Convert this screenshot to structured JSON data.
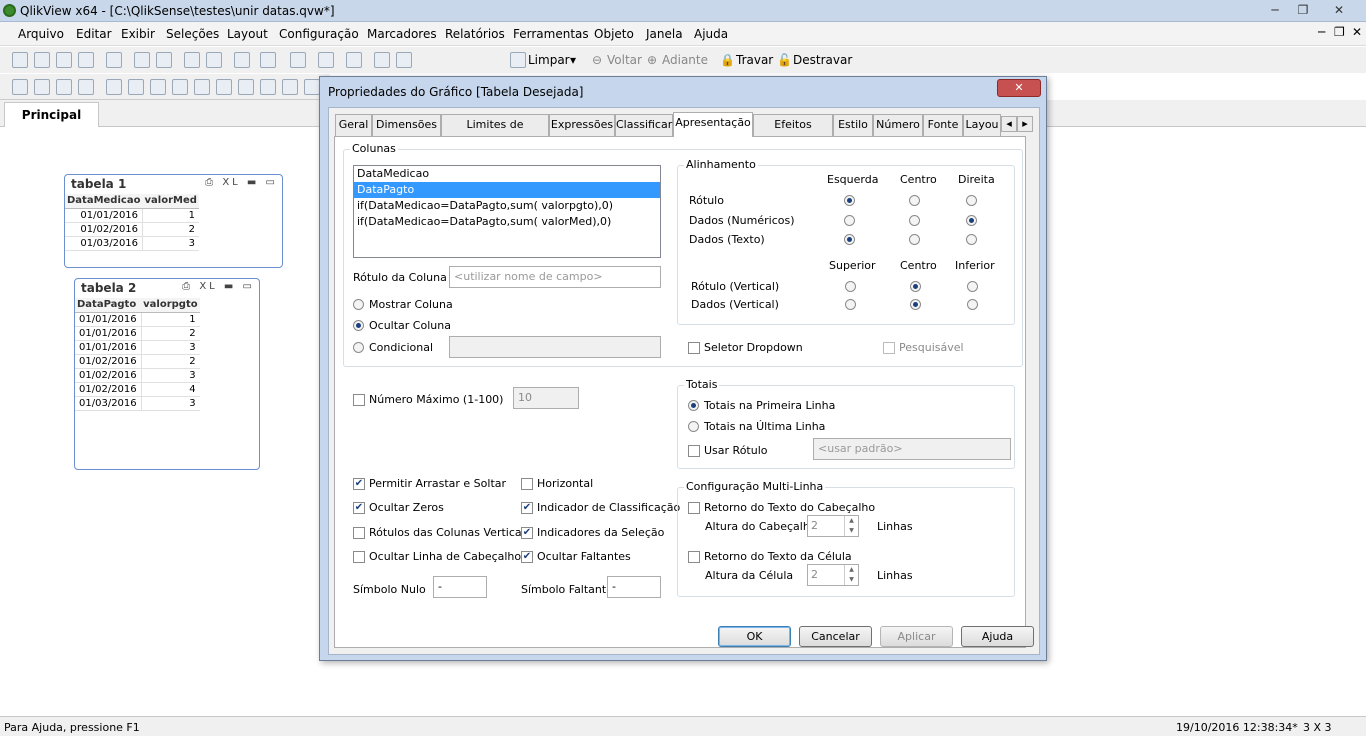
{
  "window": {
    "title": "QlikView x64 - [C:\\QlikSense\\testes\\unir datas.qvw*]",
    "min": "─",
    "max": "❐",
    "close": "✕"
  },
  "menu": [
    "Arquivo",
    "Editar",
    "Exibir",
    "Seleções",
    "Layout",
    "Configuração",
    "Marcadores",
    "Relatórios",
    "Ferramentas",
    "Objeto",
    "Janela",
    "Ajuda"
  ],
  "toolbar": {
    "limpar": "Limpar",
    "voltar": "Voltar",
    "adiante": "Adiante",
    "travar": "Travar",
    "destravar": "Destravar"
  },
  "sheet_tab": "Principal",
  "tabela1": {
    "title": "tabela 1",
    "buttons": "⎙ XL ▬ ▭",
    "headers": [
      "DataMedicao",
      "valorMed"
    ],
    "rows": [
      [
        "01/01/2016",
        "1"
      ],
      [
        "01/02/2016",
        "2"
      ],
      [
        "01/03/2016",
        "3"
      ]
    ]
  },
  "tabela2": {
    "title": "tabela 2",
    "buttons": "⎙ XL ▬ ▭",
    "headers": [
      "DataPagto",
      "valorpgto"
    ],
    "rows": [
      [
        "01/01/2016",
        "1"
      ],
      [
        "01/01/2016",
        "2"
      ],
      [
        "01/01/2016",
        "3"
      ],
      [
        "01/02/2016",
        "2"
      ],
      [
        "01/02/2016",
        "3"
      ],
      [
        "01/02/2016",
        "4"
      ],
      [
        "01/03/2016",
        "3"
      ]
    ]
  },
  "dialog": {
    "title": "Propriedades do Gráfico [Tabela Desejada]",
    "tabs": [
      "Geral",
      "Dimensões",
      "Limites de Dimensão",
      "Expressões",
      "Classificar",
      "Apresentação",
      "Efeitos Visuais",
      "Estilo",
      "Número",
      "Fonte",
      "Layou"
    ],
    "active_tab": "Apresentação",
    "colunas": {
      "legend": "Colunas",
      "items": [
        "DataMedicao",
        "DataPagto",
        "if(DataMedicao=DataPagto,sum( valorpgto),0)",
        "if(DataMedicao=DataPagto,sum( valorMed),0)"
      ],
      "selected": "DataPagto"
    },
    "rotulo_coluna": {
      "label": "Rótulo da Coluna",
      "placeholder": "<utilizar nome de campo>"
    },
    "visibility": {
      "mostrar": "Mostrar Coluna",
      "ocultar": "Ocultar Coluna",
      "condicional": "Condicional",
      "selected": "Ocultar Coluna"
    },
    "alinhamento": {
      "legend": "Alinhamento",
      "cols1": [
        "Esquerda",
        "Centro",
        "Direita"
      ],
      "rows1": [
        {
          "label": "Rótulo",
          "selected": 0
        },
        {
          "label": "Dados (Numéricos)",
          "selected": 2
        },
        {
          "label": "Dados (Texto)",
          "selected": 0
        }
      ],
      "cols2": [
        "Superior",
        "Centro",
        "Inferior"
      ],
      "rows2": [
        {
          "label": "Rótulo (Vertical)",
          "selected": 1
        },
        {
          "label": "Dados (Vertical)",
          "selected": 1
        }
      ]
    },
    "seletor_dropdown": "Seletor Dropdown",
    "pesquisavel": "Pesquisável",
    "numero_maximo": {
      "label": "Número Máximo (1-100)",
      "value": "10"
    },
    "totais": {
      "legend": "Totais",
      "primeira": "Totais na Primeira Linha",
      "ultima": "Totais na Última Linha",
      "usar_rotulo": "Usar Rótulo",
      "placeholder": "<usar padrão>",
      "selected": "Totais na Primeira Linha"
    },
    "checks": {
      "permitir_arrastar": {
        "label": "Permitir Arrastar e Soltar",
        "checked": true
      },
      "horizontal": {
        "label": "Horizontal",
        "checked": false
      },
      "ocultar_zeros": {
        "label": "Ocultar Zeros",
        "checked": true
      },
      "indicador_classificacao": {
        "label": "Indicador de Classificação",
        "checked": true
      },
      "rotulos_verticais": {
        "label": "Rótulos das Colunas Verticais",
        "checked": false
      },
      "indicadores_selecao": {
        "label": "Indicadores da Seleção",
        "checked": true
      },
      "ocultar_cabecalho": {
        "label": "Ocultar Linha de Cabeçalho",
        "checked": false
      },
      "ocultar_faltantes": {
        "label": "Ocultar Faltantes",
        "checked": true
      }
    },
    "simbolo_nulo": {
      "label": "Símbolo Nulo",
      "value": "-"
    },
    "simbolo_faltante": {
      "label": "Símbolo Faltante",
      "value": "-"
    },
    "multilinha": {
      "legend": "Configuração Multi-Linha",
      "retorno_cabecalho": "Retorno do Texto do Cabeçalho",
      "altura_cabecalho": "Altura do Cabeçalho",
      "retorno_celula": "Retorno do Texto da Célula",
      "altura_celula": "Altura da Célula",
      "value": "2",
      "linhas": "Linhas"
    },
    "buttons": {
      "ok": "OK",
      "cancelar": "Cancelar",
      "aplicar": "Aplicar",
      "ajuda": "Ajuda"
    }
  },
  "status": {
    "help": "Para Ajuda, pressione F1",
    "datetime": "19/10/2016 12:38:34*",
    "grid": "3 X 3"
  }
}
